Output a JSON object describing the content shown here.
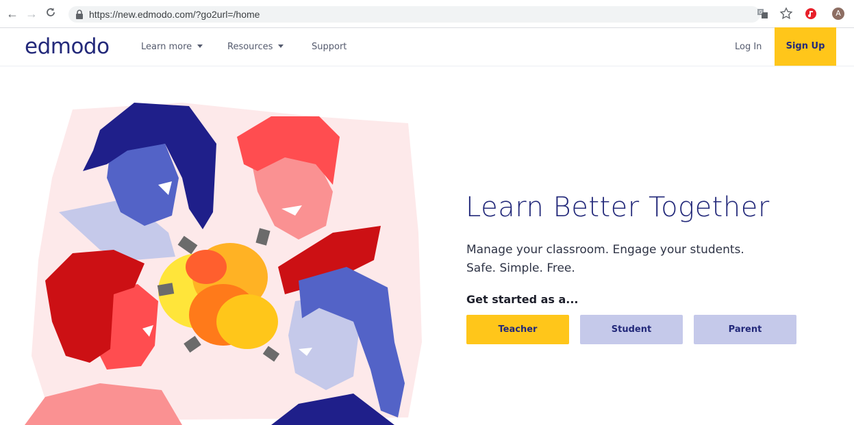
{
  "browser": {
    "url": "https://new.edmodo.com/?go2url=/home",
    "profile_initial": "A"
  },
  "header": {
    "logo": "edmodo",
    "nav": {
      "learn_more": "Learn more",
      "resources": "Resources",
      "support": "Support"
    },
    "login": "Log In",
    "signup": "Sign Up"
  },
  "hero": {
    "headline": "Learn Better Together",
    "sub_line1": "Manage your classroom. Engage your students.",
    "sub_line2": "Safe. Simple. Free.",
    "get_started": "Get started as a...",
    "roles": {
      "teacher": "Teacher",
      "student": "Student",
      "parent": "Parent"
    }
  },
  "colors": {
    "brand_navy": "#23297a",
    "accent_yellow": "#ffc61a",
    "lavender": "#c5c9ea"
  },
  "icons": [
    "back-arrow-icon",
    "forward-arrow-icon",
    "reload-icon",
    "lock-icon",
    "translate-icon",
    "star-icon",
    "extension-icon"
  ]
}
